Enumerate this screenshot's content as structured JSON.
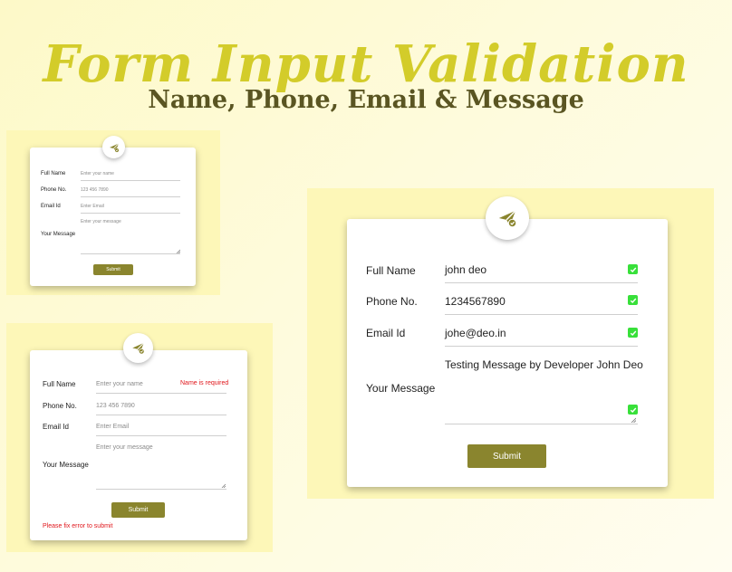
{
  "header": {
    "title": "Form Input Validation",
    "subtitle": "Name, Phone, Email & Message"
  },
  "colors": {
    "title": "#d3cc2a",
    "subtitle": "#5a5522",
    "panel": "#fdf7b8",
    "button": "#8a852e",
    "error": "#e0161b",
    "valid": "#38e03a"
  },
  "icons": {
    "badge": "paper-plane-check-icon",
    "valid": "checkmark-icon",
    "resize": "resize-grip-icon"
  },
  "form_empty": {
    "labels": {
      "name": "Full Name",
      "phone": "Phone No.",
      "email": "Email Id",
      "message": "Your Message"
    },
    "placeholders": {
      "name": "Enter your name",
      "phone": "123 456 7890",
      "email": "Enter Email",
      "message": "Enter your message"
    },
    "submit": "Submit"
  },
  "form_error": {
    "labels": {
      "name": "Full Name",
      "phone": "Phone No.",
      "email": "Email Id",
      "message": "Your Message"
    },
    "placeholders": {
      "name": "Enter your name",
      "phone": "123 456 7890",
      "email": "Enter Email",
      "message": "Enter your message"
    },
    "name_error": "Name is required",
    "submit": "Submit",
    "form_error": "Please fix error to submit"
  },
  "form_valid": {
    "labels": {
      "name": "Full Name",
      "phone": "Phone No.",
      "email": "Email Id",
      "message": "Your Message"
    },
    "values": {
      "name": "john deo",
      "phone": "1234567890",
      "email": "johe@deo.in",
      "message": "Testing Message by Developer John Deo"
    },
    "submit": "Submit"
  }
}
